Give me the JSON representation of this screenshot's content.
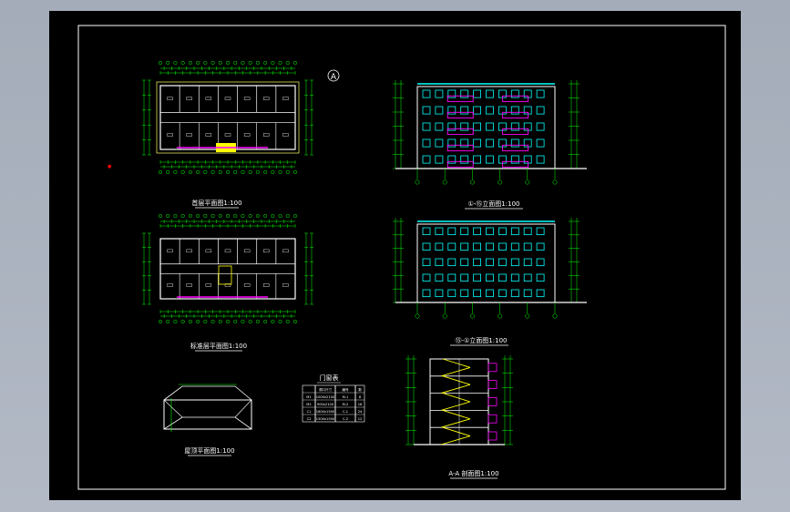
{
  "drawing": {
    "north_mark": "A",
    "ground_floor_plan_title": "首层平面图1:100",
    "standard_floor_plan_title": "标准层平面图1:100",
    "roof_plan_title": "屋顶平面图1:100",
    "south_elevation_title": "①-⑮立面图1:100",
    "north_elevation_title": "⑮-①立面图1:100",
    "section_title": "A-A 剖面图1:100",
    "door_window_table": {
      "title": "门窗表",
      "headers": [
        "",
        "洞口尺寸",
        "编号",
        "数"
      ],
      "rows": [
        [
          "M1",
          "1000x2100",
          "M-1",
          "8"
        ],
        [
          "M2",
          "900x2100",
          "M-2",
          "16"
        ],
        [
          "C1",
          "1800x1500",
          "C-1",
          "24"
        ],
        [
          "C2",
          "1500x1500",
          "C-2",
          "12"
        ]
      ]
    }
  },
  "colors": {
    "background": "#000000",
    "frame": "#ffffff",
    "wall": "#ffffff",
    "dimension": "#00ff00",
    "window": "#00ffff",
    "balcony": "#ff00ff",
    "stair": "#ffff00",
    "grid_axis": "#00ff00",
    "red_mark": "#ff0000"
  }
}
